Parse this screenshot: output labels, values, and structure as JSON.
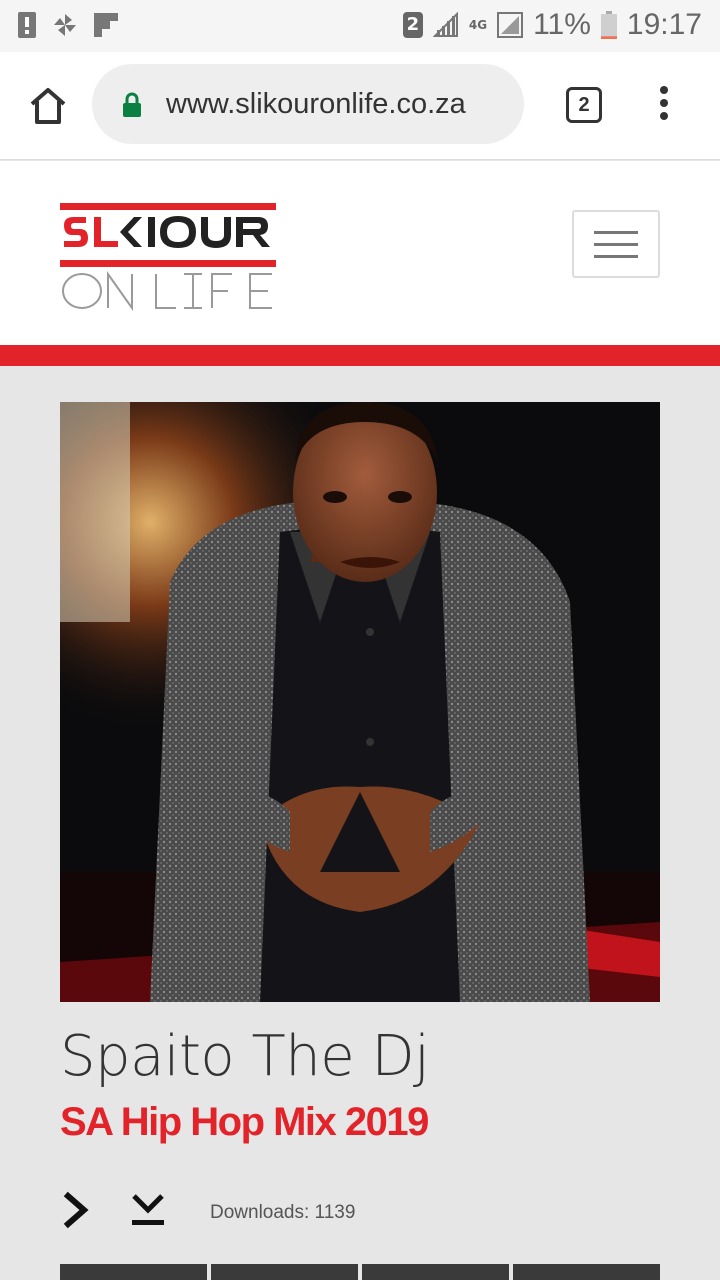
{
  "status_bar": {
    "sim": "2",
    "network": "4G",
    "battery_percent": "11%",
    "battery_level": 0.11,
    "time": "19:17",
    "icons": [
      "notification-alert-icon",
      "pinwheel-icon",
      "flipboard-icon",
      "signal-icon",
      "battery-icon"
    ]
  },
  "browser": {
    "url": "www.slikouronlife.co.za",
    "tab_count": "2",
    "icons": [
      "home-icon",
      "lock-icon",
      "more-vert-icon"
    ]
  },
  "site": {
    "logo_text_top": "SLIKOUR",
    "logo_text_bottom": "ON LIFE",
    "accent_color": "#e3232a"
  },
  "track": {
    "artist": "Spaito The Dj",
    "title": "SA Hip Hop Mix 2019",
    "downloads_label": "Downloads: 1139",
    "icons": [
      "play-icon",
      "download-icon"
    ]
  }
}
